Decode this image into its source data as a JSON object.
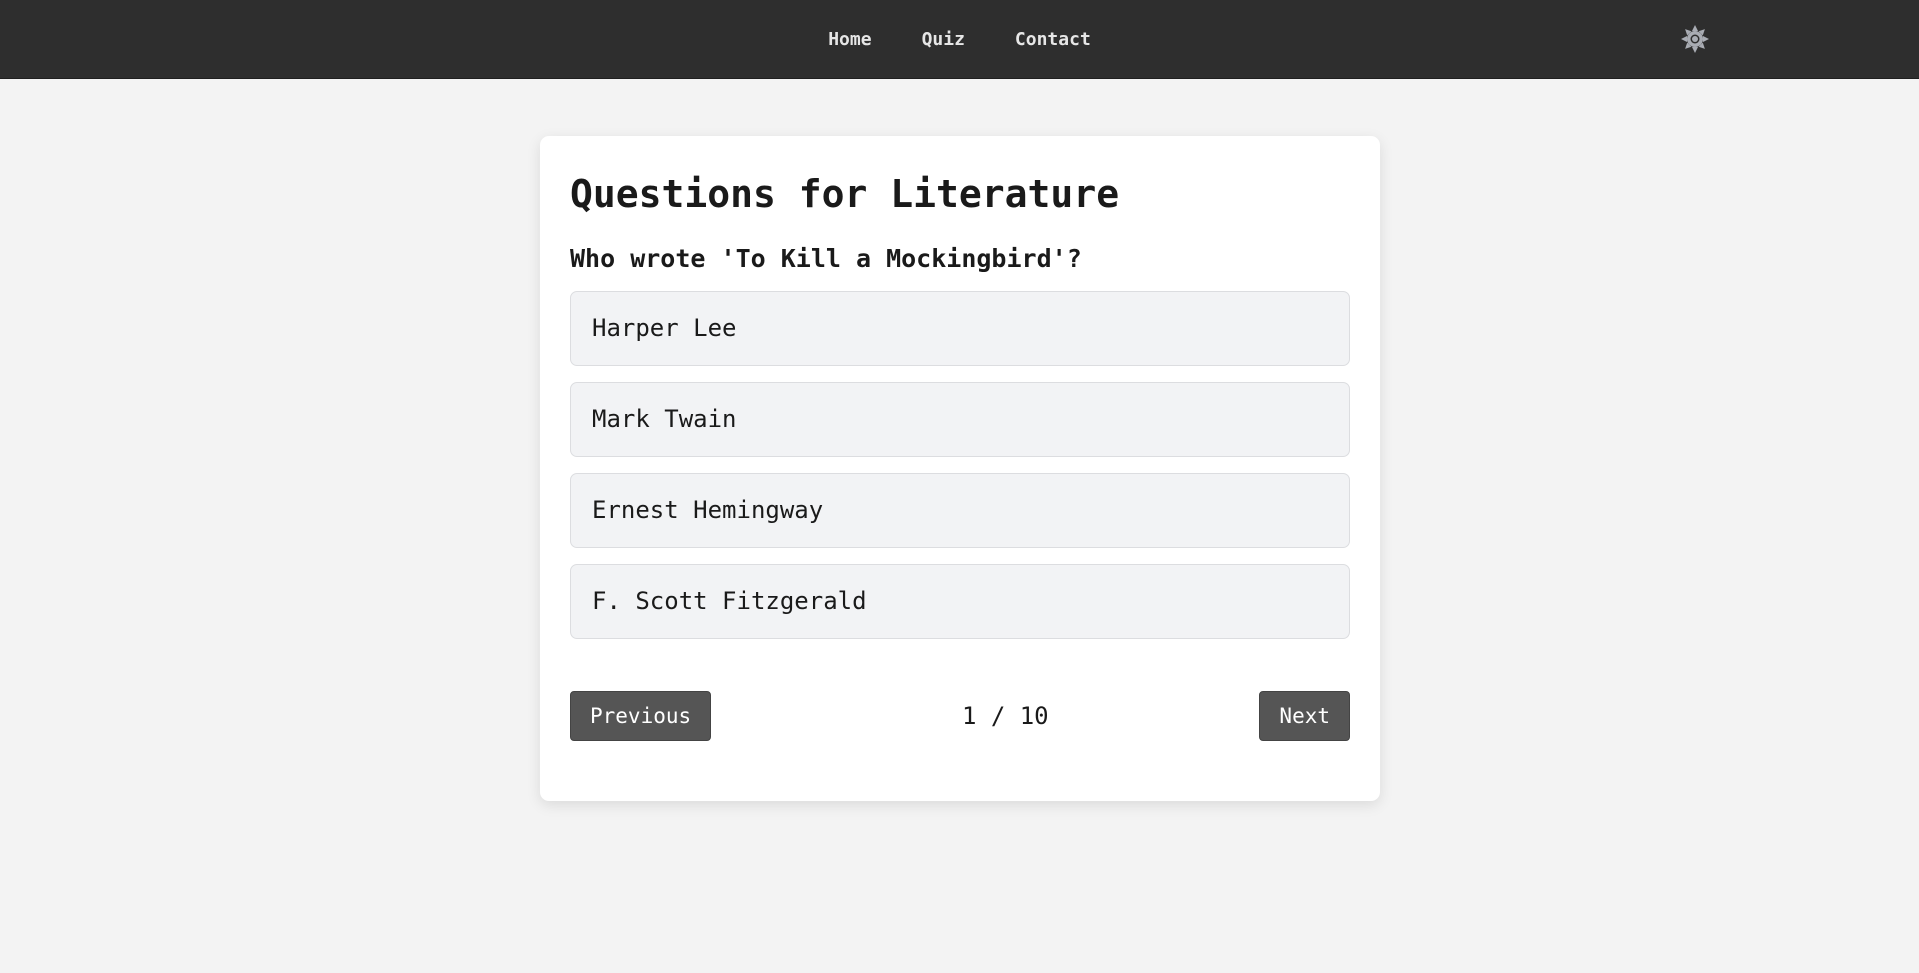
{
  "nav": {
    "links": [
      "Home",
      "Quiz",
      "Contact"
    ],
    "theme_toggle_icon": "sun-icon"
  },
  "quiz": {
    "title": "Questions for Literature",
    "question": "Who wrote 'To Kill a Mockingbird'?",
    "options": [
      "Harper Lee",
      "Mark Twain",
      "Ernest Hemingway",
      "F. Scott Fitzgerald"
    ],
    "previous_label": "Previous",
    "next_label": "Next",
    "progress": "1 / 10"
  },
  "colors": {
    "navbar": "#2e2e2e",
    "background": "#f3f3f3",
    "card": "#ffffff",
    "option_bg": "#f2f3f5",
    "button": "#555555",
    "icon": "#a9acb3"
  }
}
